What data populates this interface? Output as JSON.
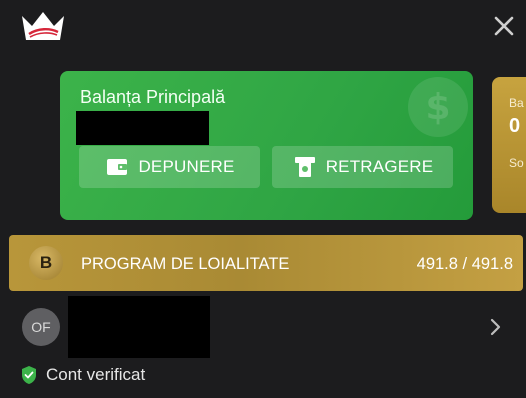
{
  "header": {
    "logo_icon": "crown-logo-icon",
    "close_icon": "close-icon"
  },
  "balance_card": {
    "title": "Balanța Principală",
    "amount": "",
    "eye_icon": "eye-icon",
    "deposit_label": "DEPUNERE",
    "deposit_icon": "wallet-icon",
    "withdraw_label": "RETRAGERE",
    "withdraw_icon": "cash-withdraw-icon",
    "color": "#2fa544"
  },
  "side_card": {
    "title_partial": "Ba",
    "value_partial": "0",
    "sub_partial": "So"
  },
  "loyalty": {
    "badge": "B",
    "label": "PROGRAM DE LOIALITATE",
    "value": "491.8 / 491.8",
    "color": "#b8963a"
  },
  "user": {
    "initials": "OF",
    "name": "",
    "chevron_icon": "chevron-right-icon"
  },
  "verification": {
    "icon": "shield-check-icon",
    "text": "Cont verificat",
    "color": "#3cb34a"
  }
}
